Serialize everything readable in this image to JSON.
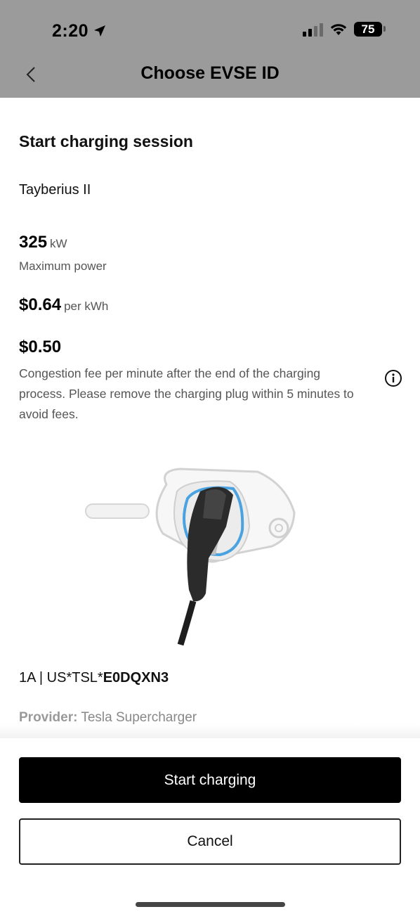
{
  "status_bar": {
    "time": "2:20",
    "battery": "75"
  },
  "nav": {
    "title": "Choose EVSE ID"
  },
  "session": {
    "heading": "Start charging session",
    "station_name": "Tayberius II",
    "power_value": "325",
    "power_unit": "kW",
    "power_label": "Maximum power",
    "price_value": "$0.64",
    "price_unit": "per kWh",
    "fee_value": "$0.50",
    "fee_description": "Congestion fee per minute after the end of the charging process. Please remove the charging plug within 5 minutes to avoid fees."
  },
  "evse": {
    "prefix": "1A | US*TSL*",
    "code": "E0DQXN3",
    "provider_label": "Provider:",
    "provider_value": "Tesla Supercharger"
  },
  "actions": {
    "start_label": "Start charging",
    "cancel_label": "Cancel"
  },
  "icons": {
    "back": "chevron-left-icon",
    "location": "location-arrow-icon",
    "signal": "cellular-signal-icon",
    "wifi": "wifi-icon",
    "battery": "battery-icon",
    "info": "info-circle-icon"
  },
  "colors": {
    "header_bg": "#9b9b9b",
    "primary_button": "#000000",
    "charger_ring": "#4aa3e0"
  }
}
